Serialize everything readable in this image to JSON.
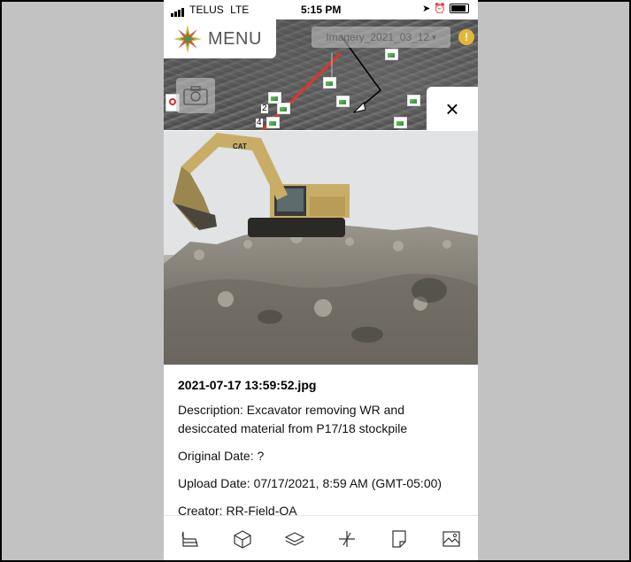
{
  "status_bar": {
    "carrier": "TELUS",
    "network": "LTE",
    "time": "5:15 PM"
  },
  "header": {
    "menu_label": "MENU"
  },
  "map": {
    "imagery_selector": "Imagery_2021_03_12",
    "warning_badge": "!",
    "pin_labels": [
      "2",
      "4"
    ],
    "path_color": "#e0352b"
  },
  "close_label": "×",
  "photo": {
    "file_name": "2021-07-17 13:59:52.jpg",
    "description": "Description: Excavator removing WR and desiccated material from P17/18 stockpile",
    "original_date": "Original Date: ?",
    "upload_date": "Upload Date: 07/17/2021, 8:59 AM (GMT-05:00)",
    "creator": "Creator: RR-Field-QA"
  },
  "toolbar": {
    "items": [
      "measure-icon",
      "cube-icon",
      "layers-icon",
      "coordinate-icon",
      "note-icon",
      "image-icon"
    ]
  },
  "colors": {
    "accent_yellow": "#d9b44a",
    "background_gray": "#c2c2c2"
  }
}
